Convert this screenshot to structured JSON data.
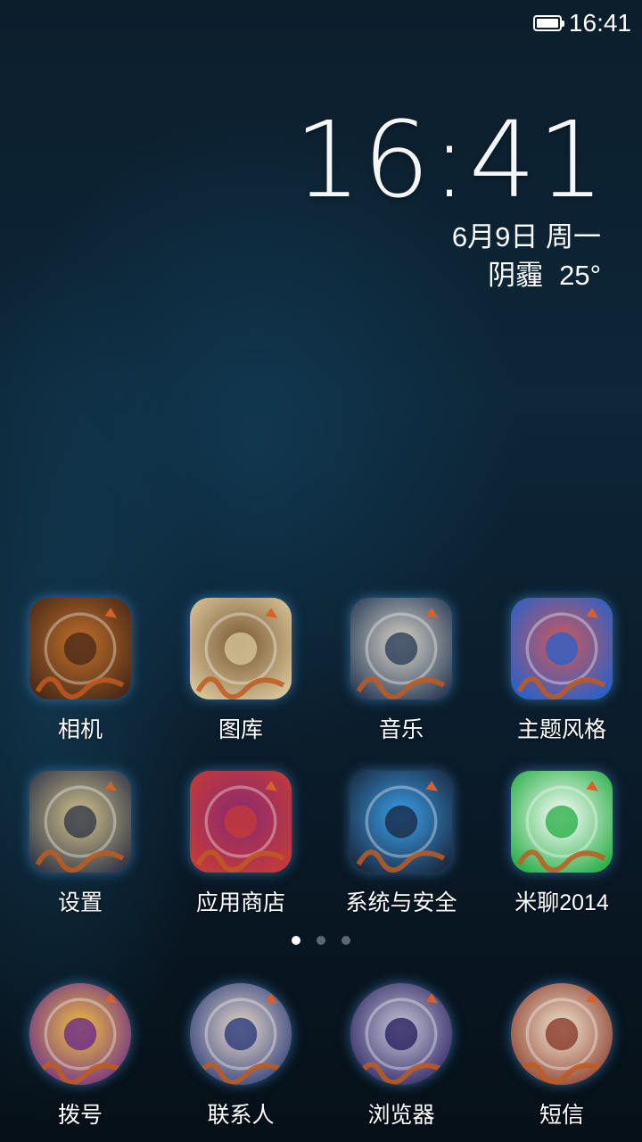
{
  "status_bar": {
    "time": "16:41",
    "battery_level": 1.0
  },
  "clock": {
    "time": "16:41",
    "date": "6月9日 周一",
    "weather": "阴霾",
    "temperature": "25°"
  },
  "apps": [
    {
      "label": "相机",
      "icon": "camera-hand-icon",
      "colors": [
        "#4a2a18",
        "#c0702a"
      ]
    },
    {
      "label": "图库",
      "icon": "gallery-scroll-icon",
      "colors": [
        "#d8c59a",
        "#7a5830"
      ]
    },
    {
      "label": "音乐",
      "icon": "pipa-lute-icon",
      "colors": [
        "#2d3f5a",
        "#d8d4c8"
      ]
    },
    {
      "label": "主题风格",
      "icon": "theme-cards-icon",
      "colors": [
        "#2a60c8",
        "#d05858"
      ]
    },
    {
      "label": "设置",
      "icon": "vajra-settings-icon",
      "colors": [
        "#34394a",
        "#d2c28a"
      ]
    },
    {
      "label": "应用商店",
      "icon": "banner-store-icon",
      "colors": [
        "#c43a3a",
        "#8a2a70"
      ]
    },
    {
      "label": "系统与安全",
      "icon": "system-security-icon",
      "colors": [
        "#1a2b44",
        "#3aa0e8"
      ]
    },
    {
      "label": "米聊2014",
      "icon": "miliao-icon",
      "colors": [
        "#2db04a",
        "#ffffff"
      ]
    }
  ],
  "dock": [
    {
      "label": "拨号",
      "icon": "dialer-icon",
      "colors": [
        "#6a2a8a",
        "#f0c040"
      ]
    },
    {
      "label": "联系人",
      "icon": "contacts-portrait-icon",
      "colors": [
        "#2a3a7a",
        "#e8d8c8"
      ]
    },
    {
      "label": "浏览器",
      "icon": "browser-moon-icon",
      "colors": [
        "#2a2060",
        "#c8c8d8"
      ]
    },
    {
      "label": "短信",
      "icon": "sms-scroll-icon",
      "colors": [
        "#8a3a2a",
        "#f0e6d0"
      ]
    }
  ],
  "page_indicator": {
    "count": 3,
    "active": 0
  }
}
